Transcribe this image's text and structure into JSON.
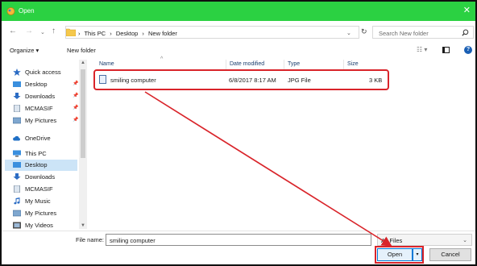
{
  "window": {
    "title": "Open",
    "close_glyph": "✕",
    "icon": "dialog-app-icon",
    "accent_color": "#2bd142"
  },
  "address_bar": {
    "back_glyph": "←",
    "forward_glyph": "→",
    "up_glyph": "↑",
    "crumbs": [
      "This PC",
      "Desktop",
      "New folder"
    ],
    "separator": "›",
    "dropdown_glyph": "⌄",
    "refresh_glyph": "↻",
    "search_placeholder": "Search New folder"
  },
  "toolbar": {
    "organize": "Organize ▾",
    "new_folder": "New folder",
    "view_glyph": "☷ ▾",
    "help_glyph": "?"
  },
  "nav_pane": {
    "items": [
      {
        "label": "Quick access",
        "icon": "star-icon",
        "pinned": false
      },
      {
        "label": "Desktop",
        "icon": "desktop-icon",
        "pinned": true
      },
      {
        "label": "Downloads",
        "icon": "download-icon",
        "pinned": true
      },
      {
        "label": "MCMASIF",
        "icon": "document-icon",
        "pinned": true
      },
      {
        "label": "My Pictures",
        "icon": "pictures-icon",
        "pinned": true
      },
      {
        "label": "OneDrive",
        "icon": "cloud-icon",
        "pinned": false
      },
      {
        "label": "This PC",
        "icon": "computer-icon",
        "pinned": false
      },
      {
        "label": "Desktop",
        "icon": "desktop-icon",
        "pinned": false,
        "selected": true
      },
      {
        "label": "Downloads",
        "icon": "download-icon",
        "pinned": false
      },
      {
        "label": "MCMASIF",
        "icon": "document-icon",
        "pinned": false
      },
      {
        "label": "My Music",
        "icon": "music-icon",
        "pinned": false
      },
      {
        "label": "My Pictures",
        "icon": "pictures-icon",
        "pinned": false
      },
      {
        "label": "My Videos",
        "icon": "videos-icon",
        "pinned": false
      }
    ],
    "pin_glyph": "📌"
  },
  "file_list": {
    "columns": [
      "Name",
      "Date modified",
      "Type",
      "Size"
    ],
    "sort_glyph": "^",
    "rows": [
      {
        "name": "smiling computer",
        "date": "6/8/2017 8:17 AM",
        "type": "JPG File",
        "size": "3 KB"
      }
    ]
  },
  "bottom": {
    "file_name_label": "File name:",
    "file_name_value": "smiling computer",
    "filter_value": "All Files",
    "filter_caret": "⌄",
    "open_label": "Open",
    "open_split_glyph": "▾",
    "cancel_label": "Cancel"
  },
  "annotation_color": "#d9242a"
}
